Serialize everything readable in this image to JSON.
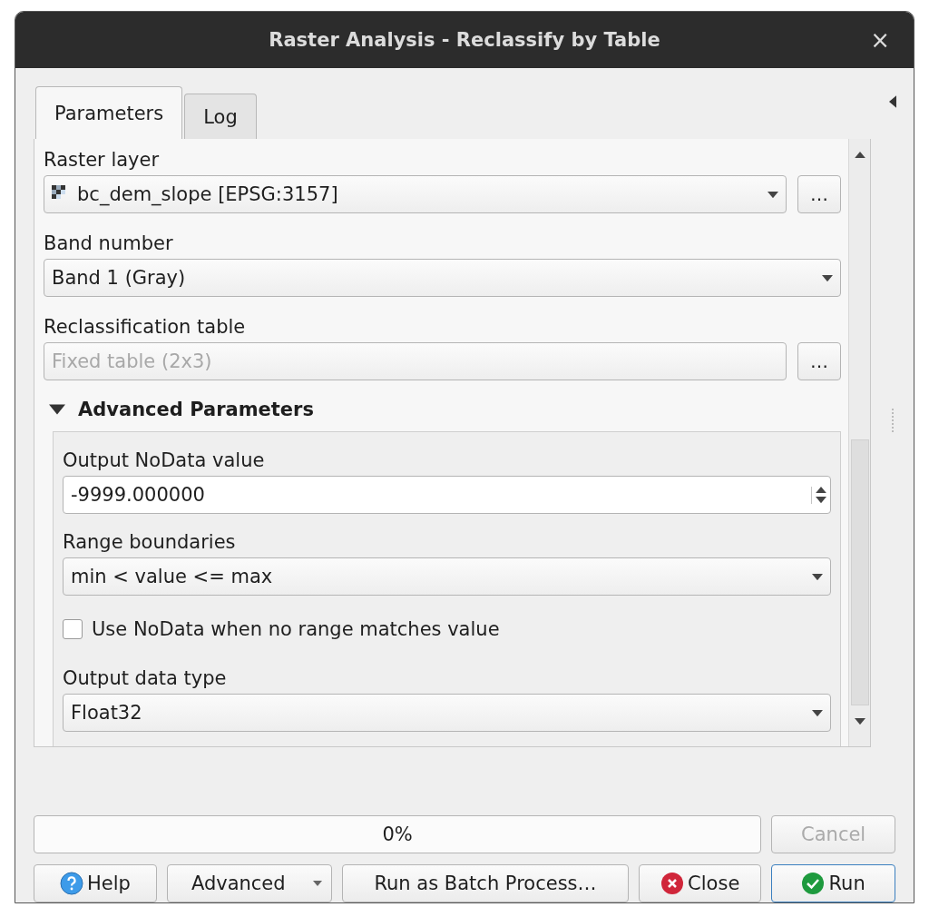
{
  "window": {
    "title": "Raster Analysis - Reclassify by Table",
    "close": "×"
  },
  "tabs": [
    {
      "label": "Parameters",
      "selected": true
    },
    {
      "label": "Log",
      "selected": false
    }
  ],
  "parameters": [
    {
      "label": "Raster layer",
      "kind": "layer_combo",
      "value": "bc_dem_slope [EPSG:3157]",
      "browse": "…"
    },
    {
      "label": "Band number",
      "kind": "combo",
      "value": "Band 1 (Gray)"
    },
    {
      "label": "Reclassification table",
      "kind": "browse_field",
      "placeholder": "Fixed table (2x3)",
      "browse": "…"
    }
  ],
  "advanced": {
    "title": "Advanced Parameters",
    "expanded": true,
    "parameters": [
      {
        "label": "Output NoData value",
        "kind": "spin",
        "value": "-9999.000000"
      },
      {
        "label": "Range boundaries",
        "kind": "combo",
        "value": "min < value <= max"
      },
      {
        "label": "Use NoData when no range matches value",
        "kind": "checkbox",
        "checked": false
      },
      {
        "label": "Output data type",
        "kind": "combo",
        "value": "Float32"
      }
    ]
  },
  "progress": {
    "text": "0%",
    "level": 0
  },
  "cancel": {
    "label": "Cancel",
    "disabled": true
  },
  "buttons": [
    {
      "label": "Help",
      "kind": "help"
    },
    {
      "label": "Advanced",
      "kind": "menu"
    },
    {
      "label": "Run as Batch Process…",
      "kind": "plain"
    },
    {
      "label": "Close",
      "kind": "close"
    },
    {
      "label": "Run",
      "kind": "run"
    }
  ]
}
